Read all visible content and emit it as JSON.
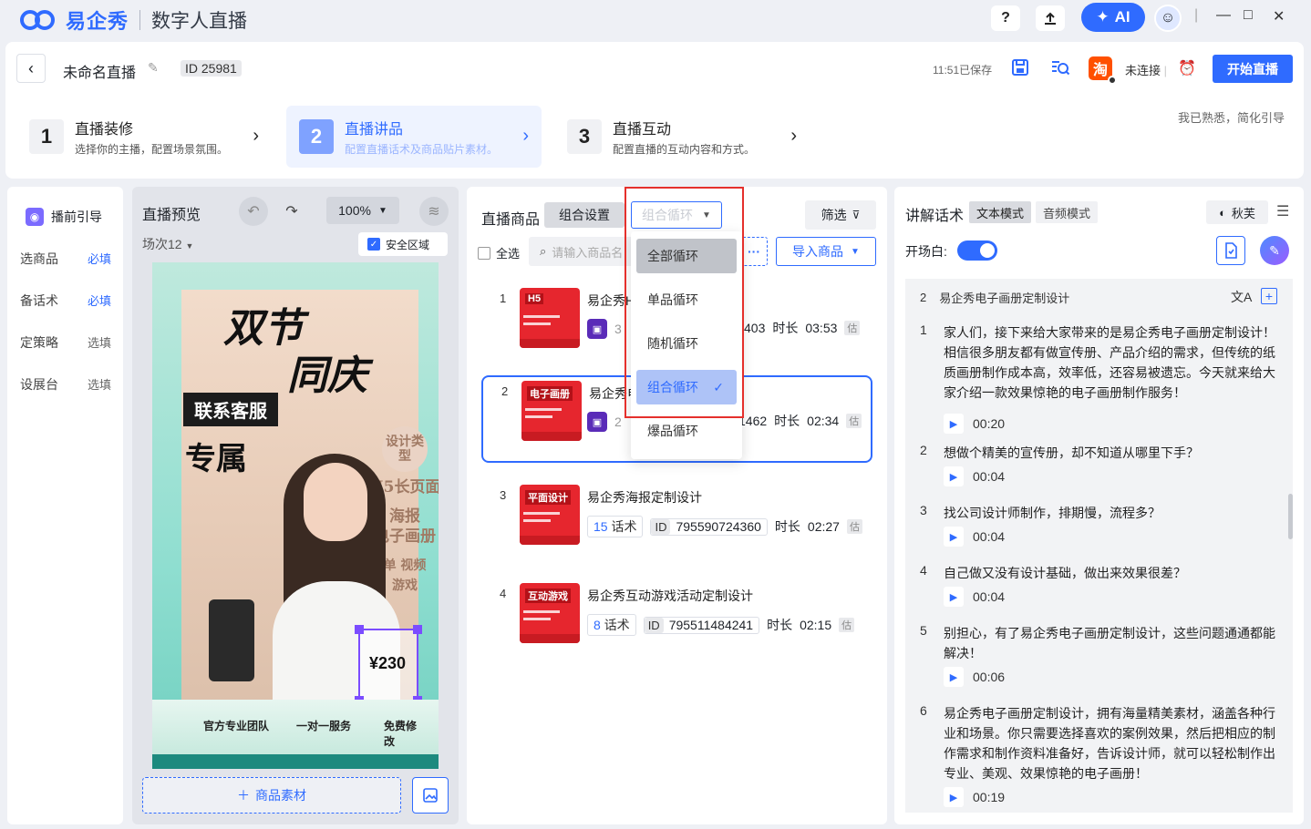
{
  "app": {
    "brand": "易企秀",
    "product": "数字人直播",
    "ai_label": "AI",
    "help": "?",
    "window": {
      "minimize": "—",
      "maximize": "□",
      "close": "✕"
    }
  },
  "header": {
    "title": "未命名直播",
    "id_label": "ID",
    "id_value": "25981",
    "saved_text": "11:51已保存",
    "platform_icon": "淘",
    "connection": "未连接",
    "start_button": "开始直播",
    "familiar_text": "我已熟悉，简化引导"
  },
  "steps": [
    {
      "num": "1",
      "title": "直播装修",
      "desc": "选择你的主播，配置场景氛围。"
    },
    {
      "num": "2",
      "title": "直播讲品",
      "desc": "配置直播话术及商品贴片素材。"
    },
    {
      "num": "3",
      "title": "直播互动",
      "desc": "配置直播的互动内容和方式。"
    }
  ],
  "sidebar": {
    "head": "播前引导",
    "items": [
      {
        "label": "选商品",
        "tag": "必填"
      },
      {
        "label": "备话术",
        "tag": "必填"
      },
      {
        "label": "定策略",
        "tag": "选填"
      },
      {
        "label": "设展台",
        "tag": "选填"
      }
    ]
  },
  "preview": {
    "title": "直播预览",
    "zoom": "100%",
    "session": "场次12",
    "safe_area": "安全区域",
    "poster": {
      "line1": "双节",
      "line2": "同庆",
      "contact": "联系客服",
      "exclusive": "专属",
      "tags": [
        "设计类型",
        "H5长页面",
        "海报",
        "电子画册",
        "单 视频",
        "游戏"
      ],
      "price": "¥230",
      "bottom": [
        "官方专业团队",
        "一对一服务",
        "免费修改"
      ]
    },
    "goods_material": "商品素材"
  },
  "goods": {
    "title": "直播商品",
    "combo_tab": "组合设置",
    "loop_select": "组合循环",
    "filter": "筛选",
    "select_all": "全选",
    "search_placeholder": "请输入商品名",
    "more": "···",
    "import": "导入商品",
    "items": [
      {
        "idx": "1",
        "name": "易企秀H",
        "id_partial": "403",
        "duration_label": "时长",
        "duration": "03:53",
        "est": "估",
        "thumb": "H5"
      },
      {
        "idx": "2",
        "name": "易企秀电",
        "id_partial": "1462",
        "duration_label": "时长",
        "duration": "02:34",
        "est": "估",
        "thumb": "电子画册"
      },
      {
        "idx": "3",
        "name": "易企秀海报定制设计",
        "talks": "15",
        "talk_unit": "话术",
        "id_label": "ID",
        "id": "795590724360",
        "duration_label": "时长",
        "duration": "02:27",
        "est": "估",
        "thumb": "平面设计"
      },
      {
        "idx": "4",
        "name": "易企秀互动游戏活动定制设计",
        "talks": "8",
        "talk_unit": "话术",
        "id_label": "ID",
        "id": "795511484241",
        "duration_label": "时长",
        "duration": "02:15",
        "est": "估",
        "thumb": "互动游戏"
      }
    ],
    "dropdown": [
      "全部循环",
      "单品循环",
      "随机循环",
      "组合循环",
      "爆品循环"
    ]
  },
  "script": {
    "title": "讲解话术",
    "mode_text": "文本模式",
    "mode_audio": "音频模式",
    "voice": "秋芙",
    "opening": "开场白:",
    "product_head": {
      "idx": "2",
      "name": "易企秀电子画册定制设计"
    },
    "items": [
      {
        "n": "1",
        "text": "家人们，接下来给大家带来的是易企秀电子画册定制设计！相信很多朋友都有做宣传册、产品介绍的需求，但传统的纸质画册制作成本高，效率低，还容易被遗忘。今天就来给大家介绍一款效果惊艳的电子画册制作服务！",
        "time": "00:20"
      },
      {
        "n": "2",
        "text": "想做个精美的宣传册，却不知道从哪里下手？",
        "time": "00:04"
      },
      {
        "n": "3",
        "text": "找公司设计师制作，排期慢，流程多？",
        "time": "00:04"
      },
      {
        "n": "4",
        "text": "自己做又没有设计基础，做出来效果很差？",
        "time": "00:04"
      },
      {
        "n": "5",
        "text": "别担心，有了易企秀电子画册定制设计，这些问题通通都能解决！",
        "time": "00:06"
      },
      {
        "n": "6",
        "text": "易企秀电子画册定制设计，拥有海量精美素材，涵盖各种行业和场景。你只需要选择喜欢的案例效果，然后把相应的制作需求和制作资料准备好，告诉设计师，就可以轻松制作出专业、美观、效果惊艳的电子画册！",
        "time": "00:19"
      }
    ]
  }
}
